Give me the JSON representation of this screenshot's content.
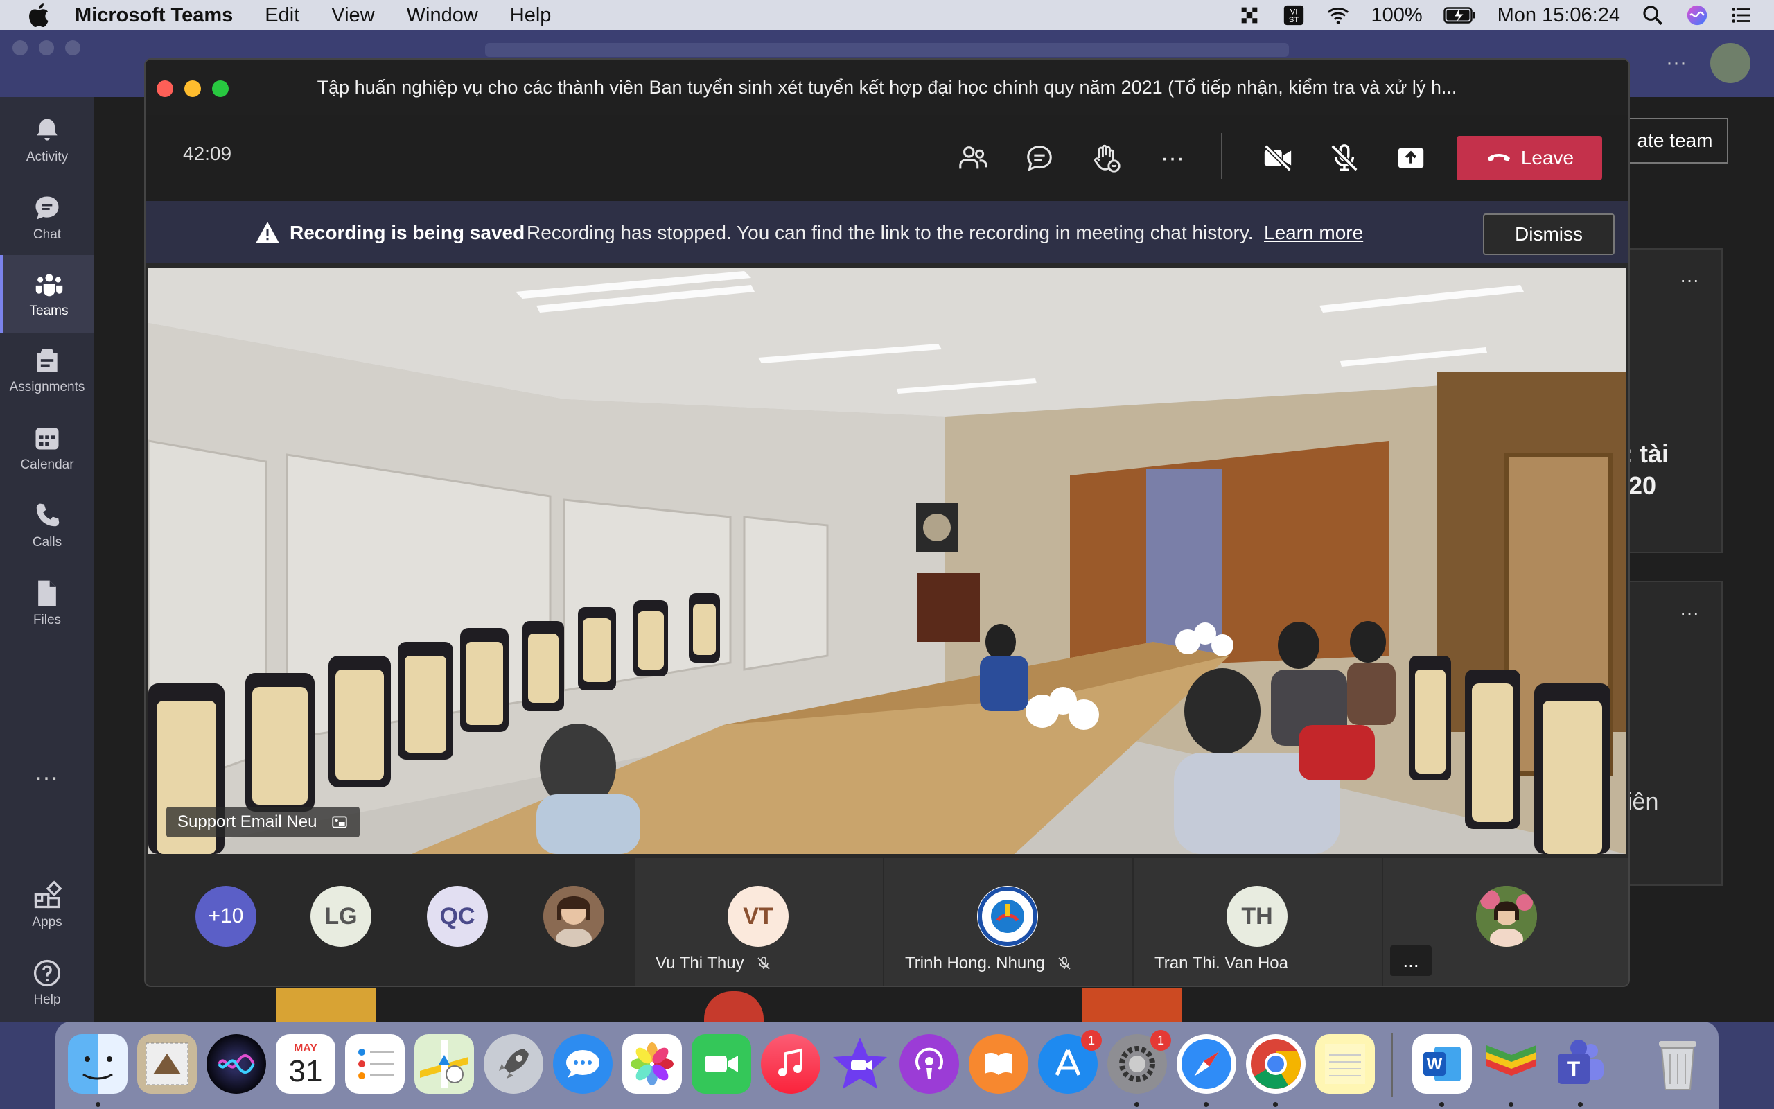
{
  "menubar": {
    "app_name": "Microsoft Teams",
    "menus": [
      "Edit",
      "View",
      "Window",
      "Help"
    ],
    "battery": "100%",
    "clock": "Mon 15:06:24"
  },
  "rail": {
    "items": [
      {
        "label": "Activity",
        "icon": "bell-icon"
      },
      {
        "label": "Chat",
        "icon": "chat-icon"
      },
      {
        "label": "Teams",
        "icon": "teams-icon"
      },
      {
        "label": "Assignments",
        "icon": "assignments-icon"
      },
      {
        "label": "Calendar",
        "icon": "calendar-icon"
      },
      {
        "label": "Calls",
        "icon": "phone-icon"
      },
      {
        "label": "Files",
        "icon": "file-icon"
      },
      {
        "label": "Apps",
        "icon": "apps-icon"
      },
      {
        "label": "Help",
        "icon": "help-icon"
      }
    ],
    "more": "..."
  },
  "background": {
    "create_team_fragment": "ate team",
    "card_text_1": ": tài",
    "card_text_2": "20",
    "card_text_3": "iên"
  },
  "meeting": {
    "title": "Tập huấn nghiệp vụ cho các thành viên Ban tuyển sinh xét tuyển kết hợp đại học chính quy năm 2021 (Tổ tiếp nhận, kiểm tra và xử lý h...",
    "timer": "42:09",
    "leave_label": "Leave",
    "banner": {
      "title": "Recording is being saved",
      "message": "Recording has stopped. You can find the link to the recording in meeting chat history.",
      "link": "Learn more",
      "dismiss": "Dismiss"
    },
    "video_label": "Support Email Neu",
    "participants": [
      {
        "initials": "+10",
        "bg": "#5b5fc7",
        "fg": "#ffffff"
      },
      {
        "initials": "LG",
        "bg": "#e8ece0",
        "fg": "#555"
      },
      {
        "initials": "QC",
        "bg": "#e2dff2",
        "fg": "#4a4a8a"
      },
      {
        "initials": "",
        "photo": true
      },
      {
        "initials": "VT",
        "name": "Vu Thi Thuy",
        "bg": "#fbe9dc",
        "fg": "#8a5030",
        "muted": true
      },
      {
        "initials": "",
        "name": "Trinh Hong. Nhung",
        "logo": true,
        "muted": true
      },
      {
        "initials": "TH",
        "name": "Tran Thi. Van Hoa",
        "bg": "#e8ece0",
        "fg": "#555"
      },
      {
        "initials": "",
        "photo": true
      }
    ],
    "overflow": "..."
  },
  "dock": {
    "calendar_month": "MAY",
    "calendar_day": "31",
    "badge_appstore": "1",
    "badge_prefs": "1"
  }
}
